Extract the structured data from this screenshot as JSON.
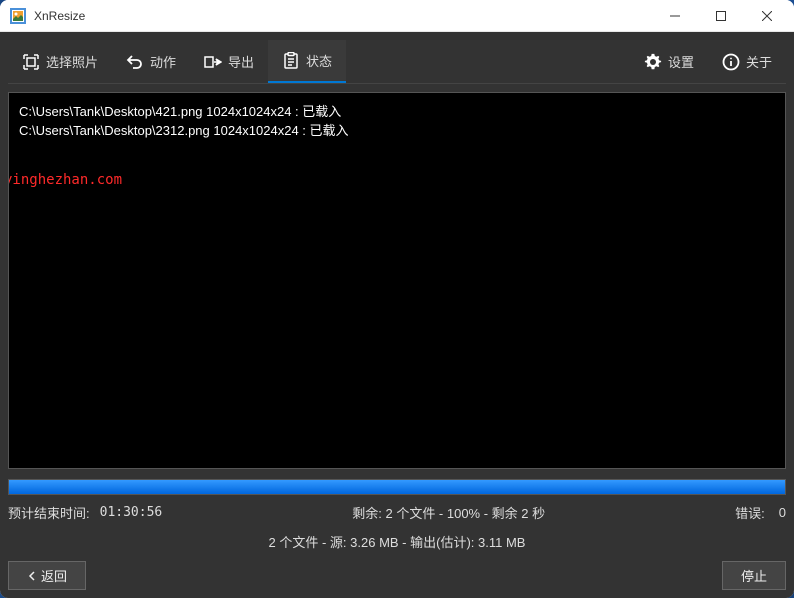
{
  "window": {
    "title": "XnResize"
  },
  "tabs": {
    "select_photos": "选择照片",
    "actions": "动作",
    "export": "导出",
    "status": "状态",
    "settings": "设置",
    "about": "关于"
  },
  "log": {
    "lines": [
      "C:\\Users\\Tank\\Desktop\\421.png 1024x1024x24 : 已载入",
      "C:\\Users\\Tank\\Desktop\\2312.png 1024x1024x24 : 已载入"
    ]
  },
  "watermark": "yinghezhan.com",
  "progress": {
    "percent": 100
  },
  "status": {
    "eta_label": "预计结束时间:",
    "eta_value": "01:30:56",
    "remaining": "剩余: 2 个文件 - 100% - 剩余 2 秒",
    "error_label": "错误:",
    "error_value": "0",
    "summary": "2 个文件 - 源: 3.26 MB - 输出(估计): 3.11 MB"
  },
  "buttons": {
    "back": "返回",
    "stop": "停止"
  }
}
